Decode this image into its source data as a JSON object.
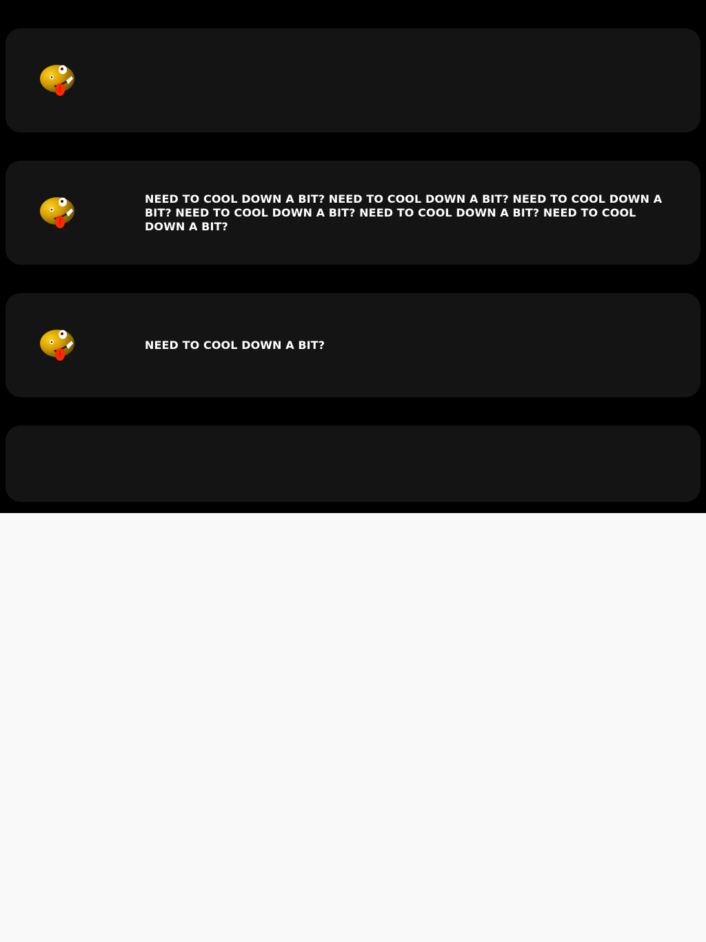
{
  "colors": {
    "page_background": "#f9f9f9",
    "feed_background": "#000000",
    "card_background": "#141414",
    "text": "#ffffff"
  },
  "cards": [
    {
      "icon": "zany-face-icon",
      "text": ""
    },
    {
      "icon": "zany-face-icon",
      "text": "NEED TO COOL DOWN A BIT?  NEED TO COOL DOWN A BIT? NEED TO COOL DOWN A BIT? NEED TO COOL DOWN A BIT? NEED TO COOL DOWN A BIT? NEED TO COOL DOWN A BIT?"
    },
    {
      "icon": "zany-face-icon",
      "text": "NEED TO COOL DOWN A BIT?"
    },
    {
      "icon": "",
      "text": ""
    }
  ]
}
